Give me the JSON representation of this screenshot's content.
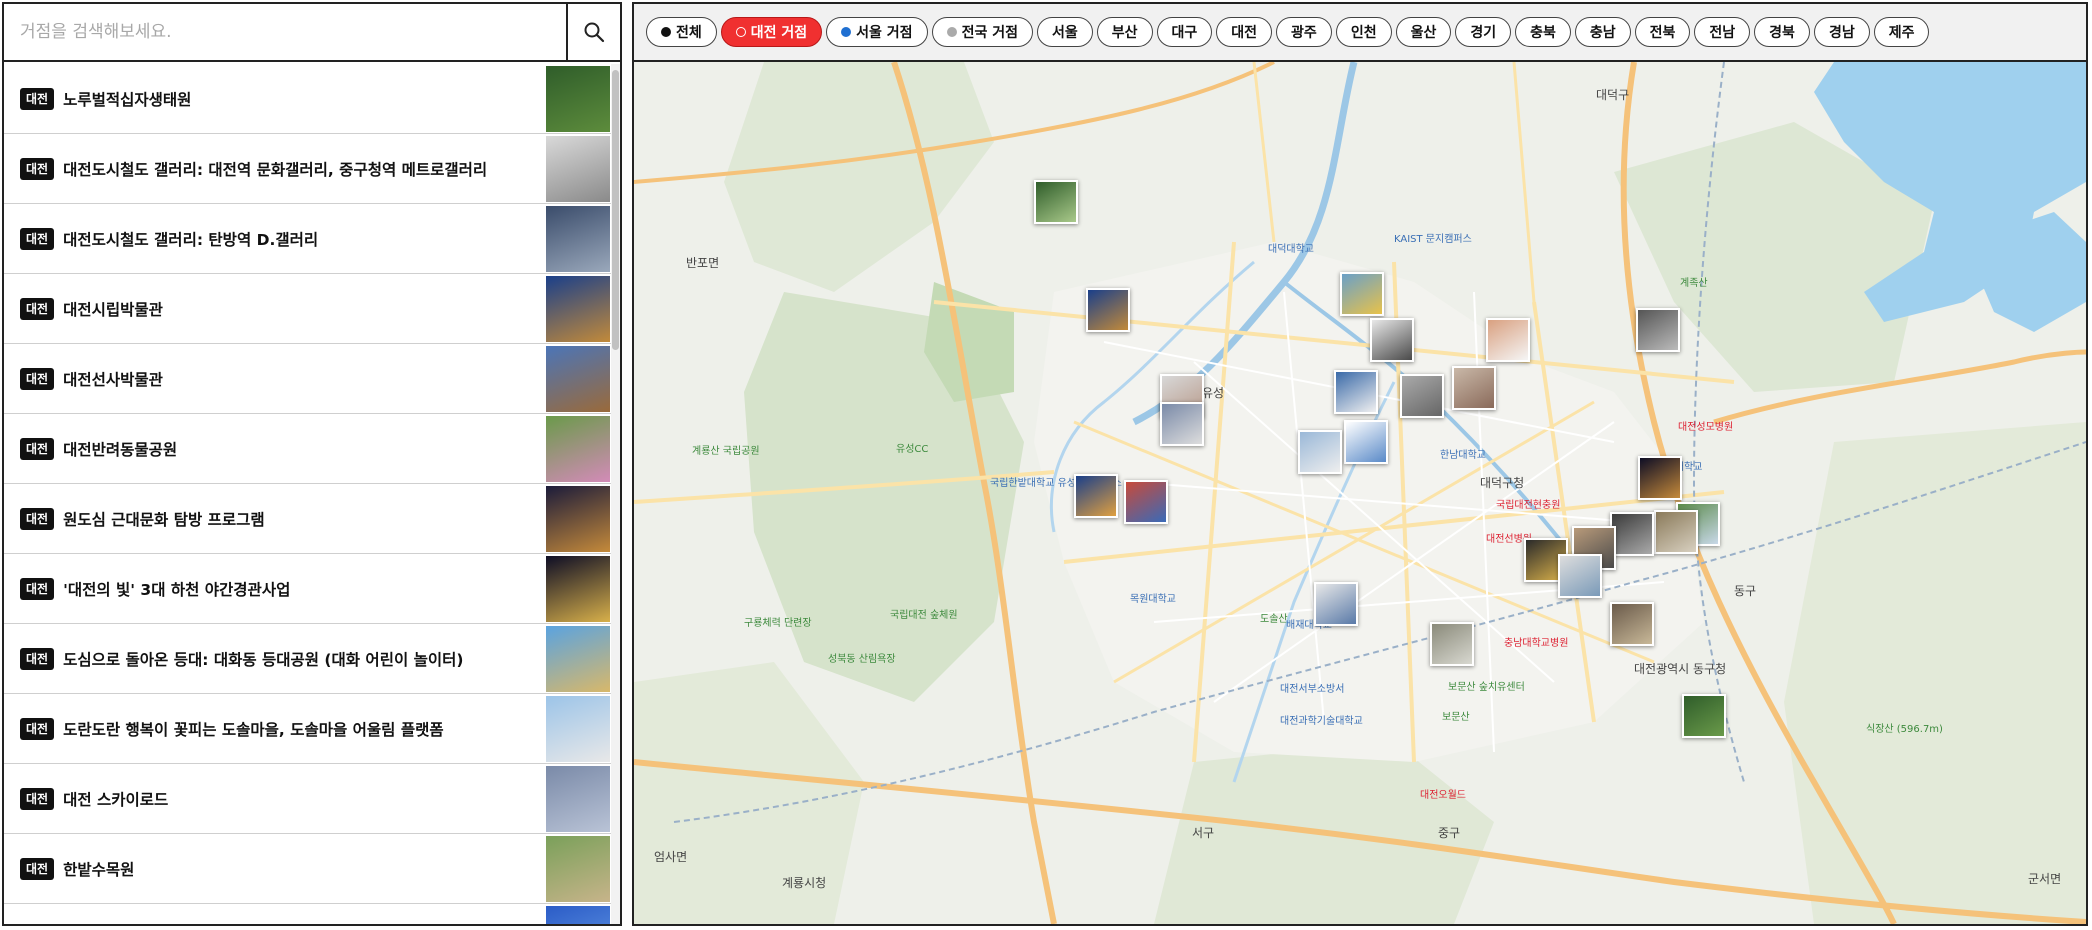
{
  "search": {
    "placeholder": "거점을 검색해보세요.",
    "button_icon": "search-icon"
  },
  "list": {
    "items": [
      {
        "badge": "대전",
        "title": "노루벌적십자생태원",
        "colors": [
          "#2f5d2a",
          "#5d8c3c"
        ]
      },
      {
        "badge": "대전",
        "title": "대전도시철도 갤러리: 대전역 문화갤러리, 중구청역 메트로갤러리",
        "colors": [
          "#d9d9d9",
          "#8a8a8a"
        ]
      },
      {
        "badge": "대전",
        "title": "대전도시철도 갤러리: 탄방역 D.갤러리",
        "colors": [
          "#3a4c6b",
          "#9aa8bb"
        ]
      },
      {
        "badge": "대전",
        "title": "대전시립박물관",
        "colors": [
          "#1a3f8a",
          "#c28a3a"
        ]
      },
      {
        "badge": "대전",
        "title": "대전선사박물관",
        "colors": [
          "#4b75b8",
          "#9a6a3a"
        ]
      },
      {
        "badge": "대전",
        "title": "대전반려동물공원",
        "colors": [
          "#6a9a4a",
          "#d38bb8"
        ]
      },
      {
        "badge": "대전",
        "title": "원도심 근대문화 탐방 프로그램",
        "colors": [
          "#1b1b3a",
          "#c58a3a"
        ]
      },
      {
        "badge": "대전",
        "title": "'대전의 빛' 3대 하천 야간경관사업",
        "colors": [
          "#0d0d25",
          "#d8b04a"
        ]
      },
      {
        "badge": "대전",
        "title": "도심으로 돌아온 등대: 대화동 등대공원 (대화 어린이 놀이터)",
        "colors": [
          "#5aa3e0",
          "#d8b86a"
        ]
      },
      {
        "badge": "대전",
        "title": "도란도란 행복이 꽃피는 도솔마을, 도솔마을 어울림 플랫폼",
        "colors": [
          "#9cc4e8",
          "#e8e8e8"
        ]
      },
      {
        "badge": "대전",
        "title": "대전 스카이로드",
        "colors": [
          "#7a8aa8",
          "#b9c3d6"
        ]
      },
      {
        "badge": "대전",
        "title": "한밭수목원",
        "colors": [
          "#7aa05a",
          "#c7b48a"
        ]
      },
      {
        "badge": "대전",
        "title": "",
        "colors": [
          "#2b5cc7",
          "#6aa0e8"
        ]
      }
    ]
  },
  "filters": [
    {
      "label": "전체",
      "dot": "#111111",
      "active": false
    },
    {
      "label": "대전 거점",
      "dot": "ring",
      "active": true
    },
    {
      "label": "서울 거점",
      "dot": "#1f6fd1",
      "active": false
    },
    {
      "label": "전국 거점",
      "dot": "#aaaaaa",
      "active": false
    },
    {
      "label": "서울",
      "dot": "",
      "active": false
    },
    {
      "label": "부산",
      "dot": "",
      "active": false
    },
    {
      "label": "대구",
      "dot": "",
      "active": false
    },
    {
      "label": "대전",
      "dot": "",
      "active": false
    },
    {
      "label": "광주",
      "dot": "",
      "active": false
    },
    {
      "label": "인천",
      "dot": "",
      "active": false
    },
    {
      "label": "울산",
      "dot": "",
      "active": false
    },
    {
      "label": "경기",
      "dot": "",
      "active": false
    },
    {
      "label": "충북",
      "dot": "",
      "active": false
    },
    {
      "label": "충남",
      "dot": "",
      "active": false
    },
    {
      "label": "전북",
      "dot": "",
      "active": false
    },
    {
      "label": "전남",
      "dot": "",
      "active": false
    },
    {
      "label": "경북",
      "dot": "",
      "active": false
    },
    {
      "label": "경남",
      "dot": "",
      "active": false
    },
    {
      "label": "제주",
      "dot": "",
      "active": false
    }
  ],
  "map": {
    "labels": [
      {
        "text": "대덕구",
        "cls": "big"
      },
      {
        "text": "반포면",
        "cls": "big"
      },
      {
        "text": "유성",
        "cls": "big"
      },
      {
        "text": "대덕구청",
        "cls": "big"
      },
      {
        "text": "대전광역시 동구청",
        "cls": "big"
      },
      {
        "text": "서구",
        "cls": "big"
      },
      {
        "text": "중구",
        "cls": "big"
      },
      {
        "text": "계룡시청",
        "cls": "big"
      },
      {
        "text": "엄사면",
        "cls": "big"
      },
      {
        "text": "군서면",
        "cls": "big"
      },
      {
        "text": "동구",
        "cls": "big"
      },
      {
        "text": "KAIST 문지캠퍼스",
        "cls": "blue"
      },
      {
        "text": "대덕대학교",
        "cls": "blue"
      },
      {
        "text": "한남대학교",
        "cls": "blue"
      },
      {
        "text": "배재대학교",
        "cls": "blue"
      },
      {
        "text": "목원대학교",
        "cls": "blue"
      },
      {
        "text": "대전보건대학교",
        "cls": "blue"
      },
      {
        "text": "국립한밭대학교 유성덕명캠퍼스",
        "cls": "blue"
      },
      {
        "text": "대전과학기술대학교",
        "cls": "blue"
      },
      {
        "text": "대전서부소방서",
        "cls": "blue"
      },
      {
        "text": "국립대전현충원",
        "cls": "red"
      },
      {
        "text": "대전선병원",
        "cls": "red"
      },
      {
        "text": "충남대학교병원",
        "cls": "red"
      },
      {
        "text": "대전성모병원",
        "cls": "red"
      },
      {
        "text": "대전오월드",
        "cls": "red"
      },
      {
        "text": "계룡산 국립공원",
        "cls": "green"
      },
      {
        "text": "계족산",
        "cls": "green"
      },
      {
        "text": "식장산 (596.7m)",
        "cls": "green"
      },
      {
        "text": "보문산 숲치유센터",
        "cls": "green"
      },
      {
        "text": "유성CC",
        "cls": "green"
      },
      {
        "text": "성북동 산림욕장",
        "cls": "green"
      },
      {
        "text": "국립대전 숲체원",
        "cls": "green"
      },
      {
        "text": "구룡체력 단련장",
        "cls": "green"
      },
      {
        "text": "도솔산",
        "cls": "green"
      },
      {
        "text": "보문산",
        "cls": "green"
      }
    ],
    "markers": [
      {
        "c1": "#2f5d2a",
        "c2": "#a9c98a"
      },
      {
        "c1": "#1a3f8a",
        "c2": "#c28a3a"
      },
      {
        "c1": "#6aa0c8",
        "c2": "#e8c24a"
      },
      {
        "c1": "#e8e8e8",
        "c2": "#4a4a4a"
      },
      {
        "c1": "#d9a080",
        "c2": "#f5f5f5"
      },
      {
        "c1": "#555555",
        "c2": "#bbbbbb"
      },
      {
        "c1": "#c9b8a8",
        "c2": "#8a6a5a"
      },
      {
        "c1": "#aaaaaa",
        "c2": "#666666"
      },
      {
        "c1": "#3a6aa8",
        "c2": "#f0f0f0"
      },
      {
        "c1": "#d8d8d8",
        "c2": "#b89a8a"
      },
      {
        "c1": "#7a8aa8",
        "c2": "#dddddd"
      },
      {
        "c1": "#1a3f8a",
        "c2": "#e0a040"
      },
      {
        "c1": "#c84a3a",
        "c2": "#3a6ab8"
      },
      {
        "c1": "#ffffff",
        "c2": "#5a8ac8"
      },
      {
        "c1": "#9ab8d8",
        "c2": "#eeeeee"
      },
      {
        "c1": "#0d0d25",
        "c2": "#c58a3a"
      },
      {
        "c1": "#5a8a4a",
        "c2": "#c8d8e8"
      },
      {
        "c1": "#8a7a5a",
        "c2": "#d8d0c0"
      },
      {
        "c1": "#3a3a3a",
        "c2": "#aaaaaa"
      },
      {
        "c1": "#b89a7a",
        "c2": "#4a4a4a"
      },
      {
        "c1": "#2a2a2a",
        "c2": "#d8b04a"
      },
      {
        "c1": "#dddddd",
        "c2": "#7a9ab8"
      },
      {
        "c1": "#6a5a4a",
        "c2": "#c8b898"
      },
      {
        "c1": "#e8e8e8",
        "c2": "#5a7aa8"
      },
      {
        "c1": "#8a8a7a",
        "c2": "#d8d8d0"
      },
      {
        "c1": "#2f5d2a",
        "c2": "#6a9a4a"
      }
    ]
  }
}
